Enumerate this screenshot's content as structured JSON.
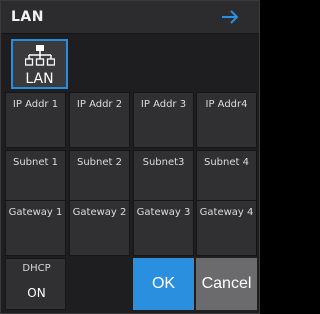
{
  "window": {
    "title": "LAN"
  },
  "header": {
    "next_icon": "arrow-right-icon"
  },
  "lan_tile": {
    "label": "LAN",
    "icon": "network-hierarchy-icon"
  },
  "grid": {
    "ip": [
      "IP Addr 1",
      "IP Addr 2",
      "IP Addr 3",
      "IP Addr4"
    ],
    "subnet": [
      "Subnet 1",
      "Subnet 2",
      "Subnet3",
      "Subnet 4"
    ],
    "gateway": [
      "Gateway 1",
      "Gateway 2",
      "Gateway 3",
      "Gateway 4"
    ]
  },
  "dhcp": {
    "label": "DHCP",
    "value": "ON"
  },
  "buttons": {
    "ok": "OK",
    "cancel": "Cancel"
  },
  "colors": {
    "accent": "#2b8fe0",
    "panel": "#1e1e20",
    "cell": "#303032",
    "cancel": "#6b6b6d"
  }
}
